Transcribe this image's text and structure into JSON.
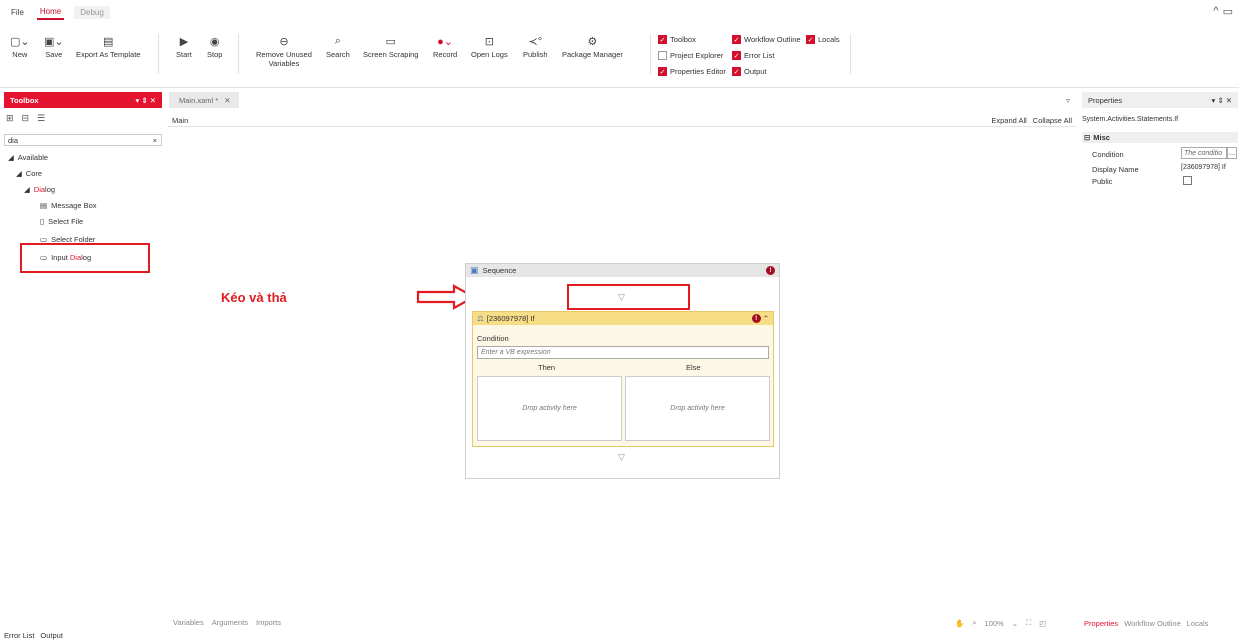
{
  "menu": {
    "file": "File",
    "home": "Home",
    "debug": "Debug"
  },
  "ribbon": {
    "new": "New",
    "save": "Save",
    "export": "Export As Template",
    "start": "Start",
    "stop": "Stop",
    "remove_unused_1": "Remove Unused",
    "remove_unused_2": "Variables",
    "search": "Search",
    "screen_scraping": "Screen Scraping",
    "record": "Record",
    "open_logs": "Open Logs",
    "publish": "Publish",
    "package_manager": "Package Manager"
  },
  "panels": {
    "toolbox": "Toolbox",
    "workflow_outline": "Workflow Outline",
    "locals": "Locals",
    "project_explorer": "Project Explorer",
    "error_list": "Error List",
    "properties_editor": "Properties Editor",
    "output": "Output"
  },
  "toolbox": {
    "title": "Toolbox",
    "search_value": "dia",
    "available": "Available",
    "core": "Core",
    "dialog_hl": "Dia",
    "dialog_rest": "log",
    "message_box": "Message Box",
    "select_file": "Select File",
    "select_folder": "Select Folder",
    "input_dialog_pre": "Input ",
    "input_dialog_hl": "Dia",
    "input_dialog_post": "log"
  },
  "doc": {
    "tab": "Main.xaml *",
    "breadcrumb": "Main",
    "expand_all": "Expand All",
    "collapse_all": "Collapse All"
  },
  "sequence": {
    "title": "Sequence",
    "if_title": "[236097978] If",
    "condition_label": "Condition",
    "condition_placeholder": "Enter a VB expression",
    "then": "Then",
    "else": "Else",
    "drop_then": "Drop activity here",
    "drop_else": "Drop activity here"
  },
  "annotation": {
    "text": "Kéo và thả",
    "color": "#e11b22"
  },
  "properties": {
    "title": "Properties",
    "type": "System.Activities.Statements.If",
    "category": "Misc",
    "condition": "Condition",
    "condition_value": "The conditio",
    "display_name": "Display Name",
    "display_name_value": "[236097978] If",
    "public": "Public"
  },
  "bottom": {
    "variables": "Variables",
    "arguments": "Arguments",
    "imports": "Imports",
    "zoom": "100%",
    "tab_properties": "Properties",
    "tab_outline": "Workflow Outline",
    "tab_locals": "Locals",
    "error_list": "Error List",
    "output": "Output"
  },
  "colors": {
    "accent": "#e5132f",
    "if_header": "#f7dd86"
  }
}
